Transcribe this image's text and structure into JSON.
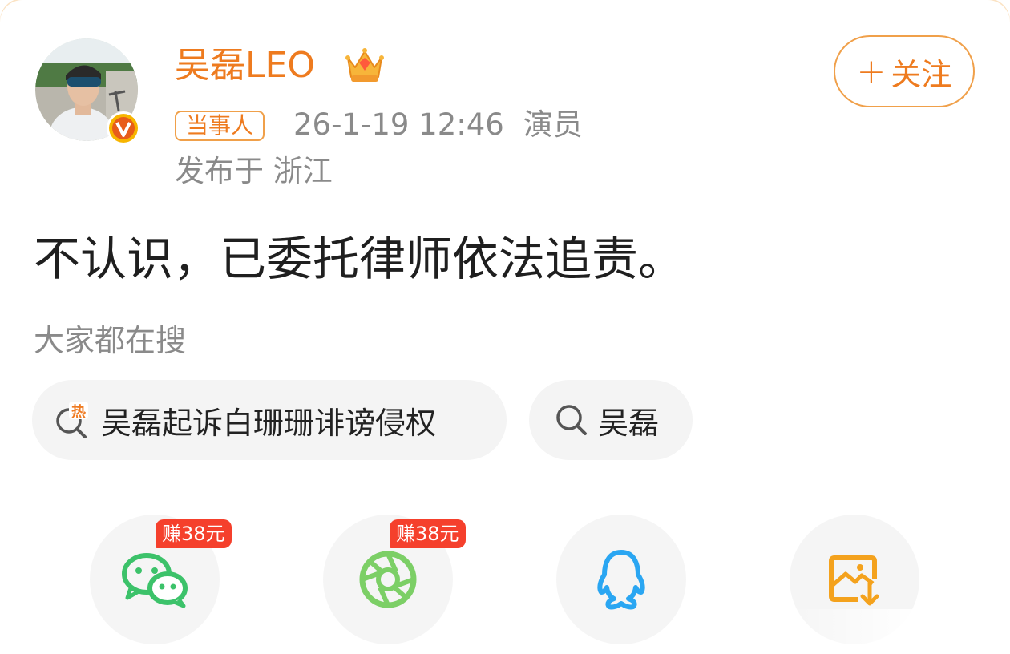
{
  "post": {
    "author": {
      "name": "吴磊LEO",
      "verified_badge": "v-badge-icon",
      "membership": "crown-icon"
    },
    "follow_button": {
      "plus": "+",
      "label": "关注"
    },
    "tag": "当事人",
    "timestamp": "26-1-19 12:46",
    "role": "演员",
    "location": "发布于 浙江",
    "content": "不认识，已委托律师依法追责。"
  },
  "search": {
    "title": "大家都在搜",
    "chips": [
      {
        "icon": "hot-search-icon",
        "text": "吴磊起诉白珊珊诽谤侵权"
      },
      {
        "icon": "search-icon",
        "text": "吴磊"
      }
    ]
  },
  "share": {
    "items": [
      {
        "icon": "wechat-icon",
        "badge": "赚38元"
      },
      {
        "icon": "moments-icon",
        "badge": "赚38元"
      },
      {
        "icon": "qq-icon"
      },
      {
        "icon": "save-image-icon"
      }
    ]
  },
  "colors": {
    "accent": "#ee7b1f",
    "earn_badge": "#f5402c",
    "wechat": "#3cc26a",
    "moments": "#7ccf66",
    "qq": "#2aa6f2",
    "save": "#f4a21d"
  }
}
